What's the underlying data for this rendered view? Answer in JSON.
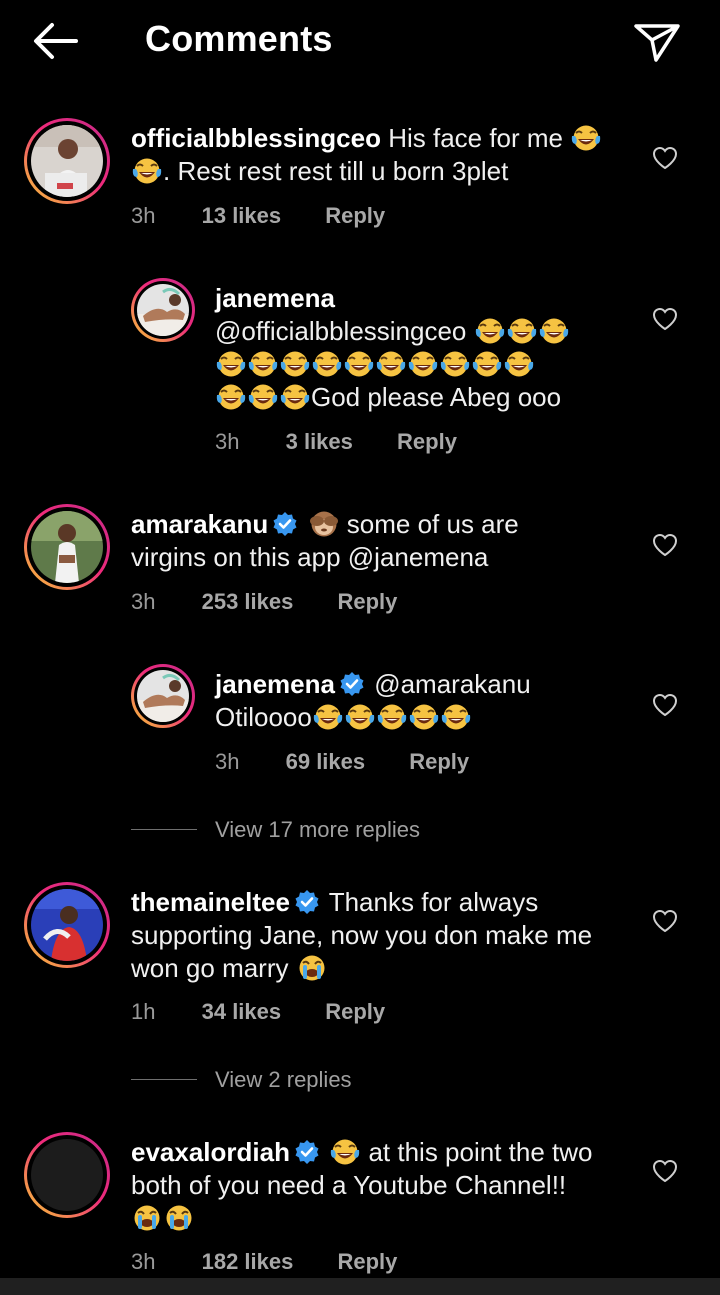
{
  "header": {
    "title": "Comments",
    "back_icon": "arrow-left-icon",
    "send_icon": "paper-plane-icon"
  },
  "colors": {
    "background": "#000000",
    "verified": "#3897f0",
    "ring_start": "#f9ce34",
    "ring_end": "#c42a8a"
  },
  "comments": [
    {
      "username": "officialbblessingceo",
      "text_1": "His face for me",
      "text_2": ". Rest rest rest till u born 3plet",
      "time": "3h",
      "likes": "13 likes",
      "reply": "Reply"
    },
    {
      "username": "janemena",
      "mention": "@officialbblessingceo",
      "text": "God please Abeg ooo",
      "time": "3h",
      "likes": "3 likes",
      "reply": "Reply"
    },
    {
      "username": "amarakanu",
      "text_1": "some of us are",
      "text_2": "virgins on this app @janemena",
      "time": "3h",
      "likes": "253 likes",
      "reply": "Reply"
    },
    {
      "username": "janemena",
      "mention": "@amarakanu",
      "text": "Otiloooo",
      "time": "3h",
      "likes": "69 likes",
      "reply": "Reply"
    },
    {
      "username": "themaineltee",
      "text_1": "Thanks for always",
      "text_2": "supporting Jane, now you don make me",
      "text_3": "won go marry",
      "time": "1h",
      "likes": "34 likes",
      "reply": "Reply"
    },
    {
      "username": "evaxalordiah",
      "text_1": "at this point the two",
      "text_2": "both of you need a Youtube Channel!!",
      "time": "3h",
      "likes": "182 likes",
      "reply": "Reply"
    }
  ],
  "view_replies": [
    "View 17 more replies",
    "View 2 replies"
  ]
}
